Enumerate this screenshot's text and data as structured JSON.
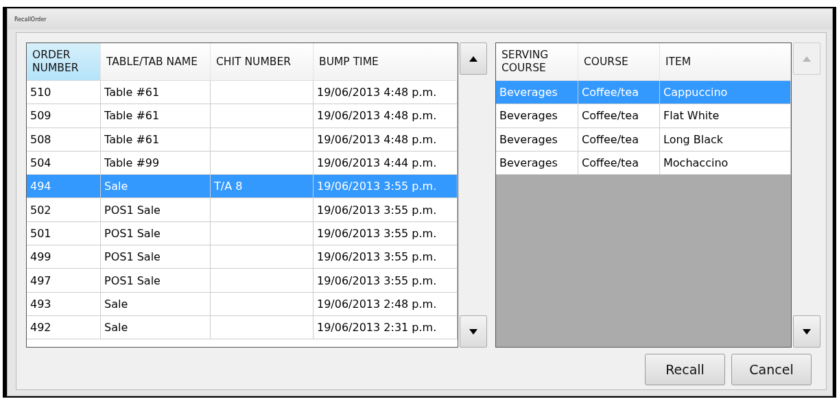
{
  "window": {
    "title": "RecallOrder"
  },
  "orders": {
    "columns": [
      {
        "label": "ORDER NUMBER",
        "selected": true
      },
      {
        "label": "TABLE/TAB NAME",
        "selected": false
      },
      {
        "label": "CHIT NUMBER",
        "selected": false
      },
      {
        "label": "BUMP TIME",
        "selected": false
      }
    ],
    "rows": [
      {
        "cells": [
          "510",
          "Table #61",
          "",
          "19/06/2013 4:48 p.m."
        ],
        "selected": false
      },
      {
        "cells": [
          "509",
          "Table #61",
          "",
          "19/06/2013 4:48 p.m."
        ],
        "selected": false
      },
      {
        "cells": [
          "508",
          "Table #61",
          "",
          "19/06/2013 4:48 p.m."
        ],
        "selected": false
      },
      {
        "cells": [
          "504",
          "Table #99",
          "",
          "19/06/2013 4:44 p.m."
        ],
        "selected": false
      },
      {
        "cells": [
          "494",
          "Sale",
          "T/A 8",
          "19/06/2013 3:55 p.m."
        ],
        "selected": true
      },
      {
        "cells": [
          "502",
          "POS1 Sale",
          "",
          "19/06/2013 3:55 p.m."
        ],
        "selected": false
      },
      {
        "cells": [
          "501",
          "POS1 Sale",
          "",
          "19/06/2013 3:55 p.m."
        ],
        "selected": false
      },
      {
        "cells": [
          "499",
          "POS1 Sale",
          "",
          "19/06/2013 3:55 p.m."
        ],
        "selected": false
      },
      {
        "cells": [
          "497",
          "POS1 Sale",
          "",
          "19/06/2013 3:55 p.m."
        ],
        "selected": false
      },
      {
        "cells": [
          "493",
          "Sale",
          "",
          "19/06/2013 2:48 p.m."
        ],
        "selected": false
      },
      {
        "cells": [
          "492",
          "Sale",
          "",
          "19/06/2013 2:31 p.m."
        ],
        "selected": false
      }
    ],
    "scroll_up": {
      "disabled": false
    },
    "scroll_down": {
      "disabled": false
    }
  },
  "items": {
    "columns": [
      {
        "label": "SERVING COURSE",
        "selected": false
      },
      {
        "label": "COURSE",
        "selected": false
      },
      {
        "label": "ITEM",
        "selected": false
      }
    ],
    "rows": [
      {
        "cells": [
          "Beverages",
          "Coffee/tea",
          "Cappuccino"
        ],
        "selected": true
      },
      {
        "cells": [
          "Beverages",
          "Coffee/tea",
          "Flat White"
        ],
        "selected": false
      },
      {
        "cells": [
          "Beverages",
          "Coffee/tea",
          "Long Black"
        ],
        "selected": false
      },
      {
        "cells": [
          "Beverages",
          "Coffee/tea",
          "Mochaccino"
        ],
        "selected": false
      }
    ],
    "scroll_up": {
      "disabled": true
    },
    "scroll_down": {
      "disabled": false
    }
  },
  "buttons": [
    "Recall",
    "Cancel"
  ]
}
